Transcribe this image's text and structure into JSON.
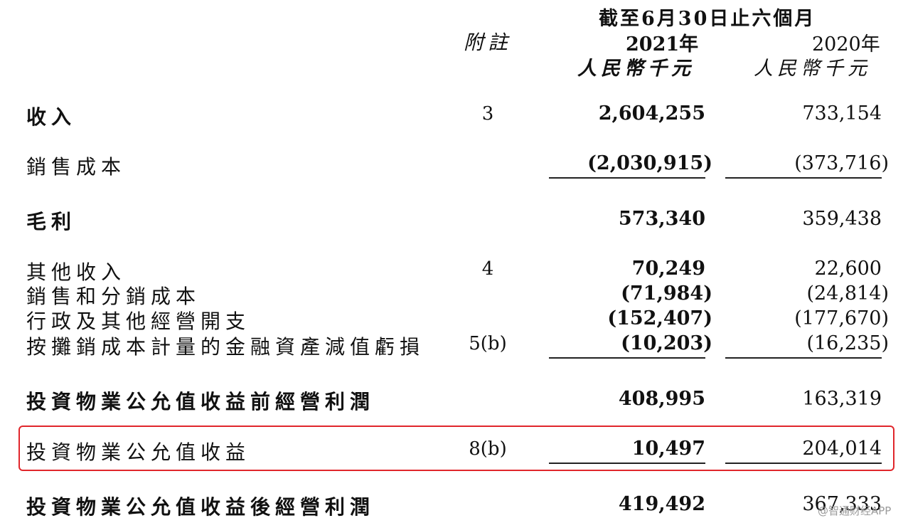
{
  "header": {
    "period": "截至6月30日止六個月",
    "note_col": "附註",
    "year_current": "2021年",
    "year_prior": "2020年",
    "unit_current": "人民幣千元",
    "unit_prior": "人民幣千元"
  },
  "rows": [
    {
      "label": "收入",
      "note": "3",
      "current": "2,604,255",
      "prior": "733,154"
    },
    {
      "label": "銷售成本",
      "note": "",
      "current": "(2,030,915)",
      "prior": "(373,716)"
    },
    {
      "label": "毛利",
      "note": "",
      "current": "573,340",
      "prior": "359,438"
    },
    {
      "label": "其他收入",
      "note": "4",
      "current": "70,249",
      "prior": "22,600"
    },
    {
      "label": "銷售和分銷成本",
      "note": "",
      "current": "(71,984)",
      "prior": "(24,814)"
    },
    {
      "label": "行政及其他經營開支",
      "note": "",
      "current": "(152,407)",
      "prior": "(177,670)"
    },
    {
      "label": "按攤銷成本計量的金融資產減值虧損",
      "note": "5(b)",
      "current": "(10,203)",
      "prior": "(16,235)"
    },
    {
      "label": "投資物業公允值收益前經營利潤",
      "note": "",
      "current": "408,995",
      "prior": "163,319"
    },
    {
      "label": "投資物業公允值收益",
      "note": "8(b)",
      "current": "10,497",
      "prior": "204,014"
    },
    {
      "label": "投資物業公允值收益後經營利潤",
      "note": "",
      "current": "419,492",
      "prior": "367,333"
    }
  ],
  "watermark": "@智通财经APP",
  "colors": {
    "highlight": "#e0262b",
    "text": "#111111"
  }
}
